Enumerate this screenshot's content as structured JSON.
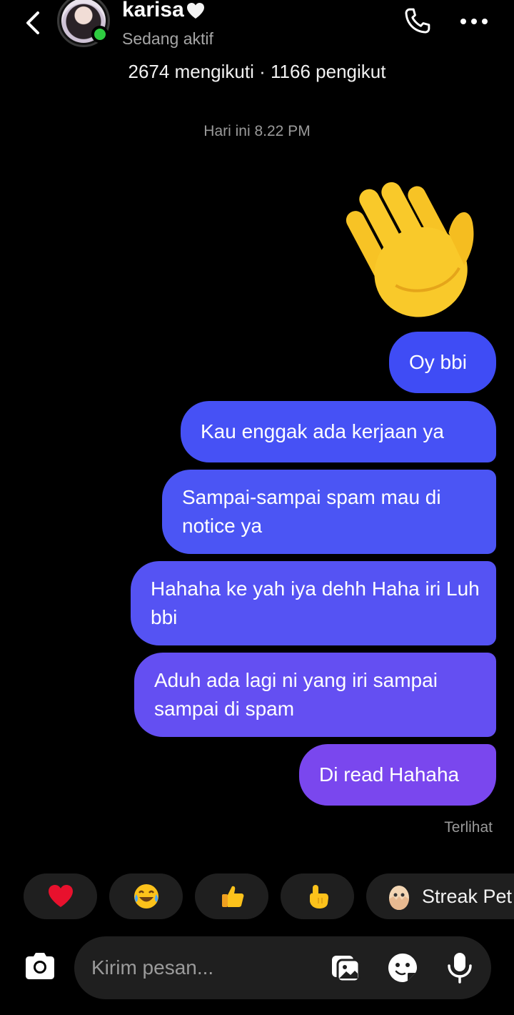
{
  "header": {
    "name": "karisa",
    "status": "Sedang aktif",
    "following_count": "2674",
    "following_label": "mengikuti",
    "separator": "·",
    "followers_count": "1166",
    "followers_label": "pengikut"
  },
  "chat": {
    "timestamp": "Hari ini 8.22 PM",
    "sent_emoji": "waving-hand",
    "messages": [
      "Oy bbi",
      "Kau enggak ada kerjaan ya",
      "Sampai-sampai spam mau di notice ya",
      "Hahaha ke yah iya dehh Haha iri Luh bbi",
      "Aduh ada lagi ni yang iri sampai sampai di spam",
      "Di read Hahaha"
    ],
    "seen_label": "Terlihat"
  },
  "quick_reactions": {
    "items": [
      "heart",
      "tears-of-joy",
      "thumbs-up",
      "pointing-hand"
    ],
    "streak_label": "Streak Pet"
  },
  "composer": {
    "placeholder": "Kirim pesan..."
  },
  "colors": {
    "background": "#000000",
    "bubble_start": "#3f4cf5",
    "bubble_end": "#7a47ee",
    "online": "#2ecc40",
    "chip": "#1f1f1f"
  }
}
